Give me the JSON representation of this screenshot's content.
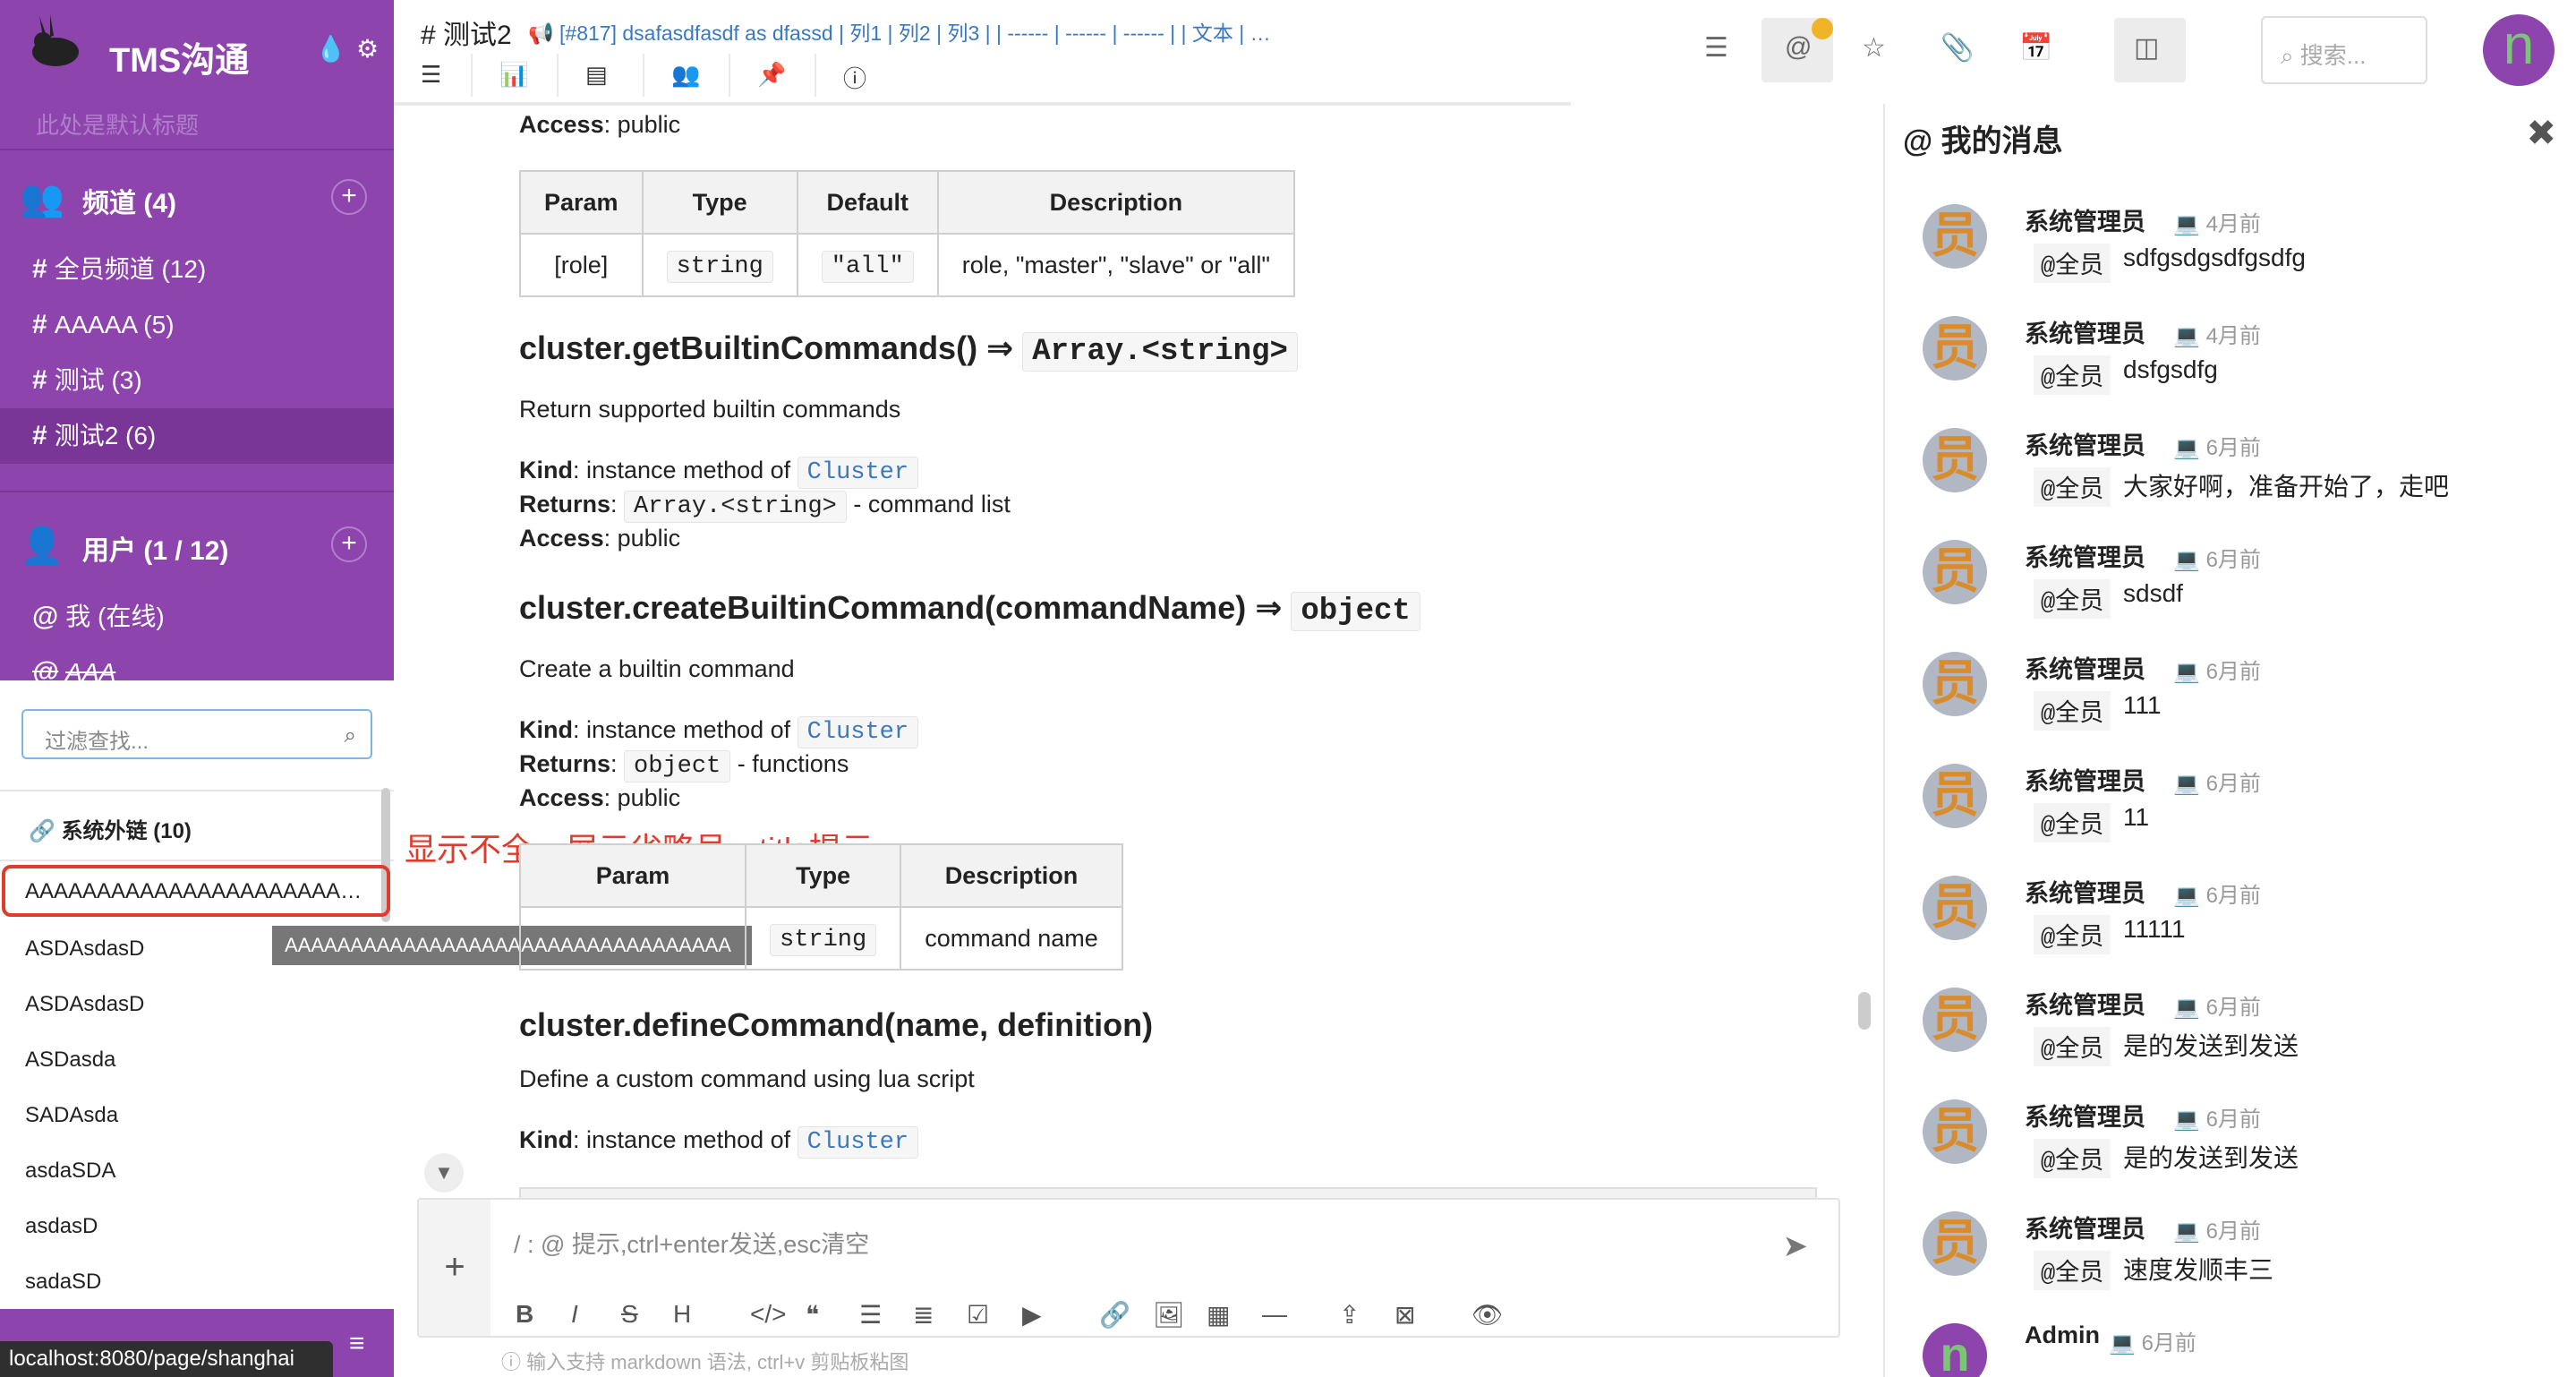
{
  "app": {
    "title": "TMS沟通",
    "subtitle": "此处是默认标题"
  },
  "sidebar": {
    "channels": {
      "label": "频道 (4)",
      "items": [
        {
          "label": "全员频道 (12)"
        },
        {
          "label": "AAAAA (5)"
        },
        {
          "label": "测试 (3)"
        },
        {
          "label": "测试2 (6)"
        }
      ]
    },
    "users": {
      "label": "用户 (1 / 12)",
      "items": [
        {
          "label": "我 (在线)"
        },
        {
          "label": "AAA"
        }
      ]
    }
  },
  "popup": {
    "filter_placeholder": "过滤查找...",
    "links_header": "系统外链 (10)",
    "links": [
      "AAAAAAAAAAAAAAAAAAAAAAAAAAAAAAAAAA",
      "ASDAsdasD",
      "ASDAsdasD",
      "ASDasda",
      "SADAsda",
      "asdaSDA",
      "asdasD",
      "sadaSD"
    ],
    "tooltip": "AAAAAAAAAAAAAAAAAAAAAAAAAAAAAAAAAA"
  },
  "annotation": "显示不全，展示省略号，title提示",
  "status_url": "localhost:8080/page/shanghai",
  "header": {
    "channel": "# 测试2",
    "description": "[#817] dsafasdfasdf as dfassd | 列1 | 列2 | 列3 | | ------ | ------ | ------ | | 文本 | …",
    "search_placeholder": "搜索...",
    "avatar_letter": "n"
  },
  "doc": {
    "access_top": "public",
    "table1": {
      "headers": [
        "Param",
        "Type",
        "Default",
        "Description"
      ],
      "row": [
        "[role]",
        "string",
        "\"all\"",
        "role, \"master\", \"slave\" or \"all\""
      ]
    },
    "m1": {
      "name": "cluster.getBuiltinCommands() ⇒",
      "ret": "Array.<string>",
      "desc": "Return supported builtin commands",
      "kind": "Cluster",
      "returns": "Array.<string>",
      "returns_desc": "- command list",
      "access": "public"
    },
    "m2": {
      "name": "cluster.createBuiltinCommand(commandName) ⇒",
      "ret": "object",
      "desc": "Create a builtin command",
      "kind": "Cluster",
      "returns": "object",
      "returns_desc": "- functions",
      "access": "public"
    },
    "table2": {
      "headers": [
        "Param",
        "Type",
        "Description"
      ],
      "row": [
        "",
        "string",
        "command name"
      ]
    },
    "m3": {
      "name": "cluster.defineCommand(name, definition)",
      "desc": "Define a custom command using lua script",
      "kind": "Cluster"
    },
    "labels": {
      "kind": "Kind",
      "kind_suffix": ": instance method of",
      "returns": "Returns",
      "access": "Access"
    }
  },
  "editor": {
    "placeholder": "/ : @ 提示,ctrl+enter发送,esc清空",
    "hint": "输入支持 markdown 语法, ctrl+v 剪贴板粘图"
  },
  "messages_panel": {
    "title": "我的消息",
    "items": [
      {
        "name": "系统管理员",
        "time": "4月前",
        "tag": "@全员",
        "text": "sdfgsdgsdfgsdfg"
      },
      {
        "name": "系统管理员",
        "time": "4月前",
        "tag": "@全员",
        "text": "dsfgsdfg"
      },
      {
        "name": "系统管理员",
        "time": "6月前",
        "tag": "@全员",
        "text": "大家好啊，准备开始了，走吧"
      },
      {
        "name": "系统管理员",
        "time": "6月前",
        "tag": "@全员",
        "text": "sdsdf"
      },
      {
        "name": "系统管理员",
        "time": "6月前",
        "tag": "@全员",
        "text": "111"
      },
      {
        "name": "系统管理员",
        "time": "6月前",
        "tag": "@全员",
        "text": "11"
      },
      {
        "name": "系统管理员",
        "time": "6月前",
        "tag": "@全员",
        "text": "11111"
      },
      {
        "name": "系统管理员",
        "time": "6月前",
        "tag": "@全员",
        "text": "是的发送到发送"
      },
      {
        "name": "系统管理员",
        "time": "6月前",
        "tag": "@全员",
        "text": "是的发送到发送"
      },
      {
        "name": "系统管理员",
        "time": "6月前",
        "tag": "@全员",
        "text": "速度发顺丰三"
      },
      {
        "name": "Admin",
        "time": "6月前",
        "tag": "",
        "text": ""
      }
    ]
  },
  "colors": {
    "sidebar": "#8e44ad",
    "highlight": "#e03b2c",
    "link": "#3a78c2",
    "badge": "#f0b429"
  }
}
